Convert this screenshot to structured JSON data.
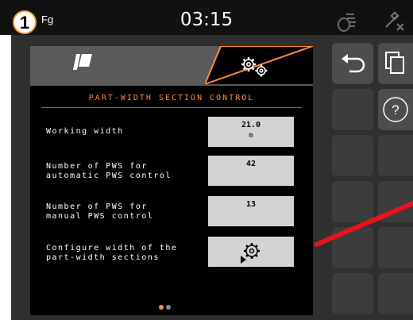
{
  "callout": "1",
  "status_bar": {
    "left_label": "Fg",
    "time": "03:15",
    "icons": [
      "wheel-icon",
      "satellite-disabled-icon"
    ]
  },
  "tabs": [
    {
      "icon": "implement-icon",
      "active": false
    },
    {
      "icon": "settings-gears-icon",
      "active": true
    }
  ],
  "panel": {
    "title": "PART-WIDTH SECTION CONTROL",
    "rows": [
      {
        "label": "Working width",
        "value": "21.0",
        "unit": "m"
      },
      {
        "label": "Number of PWS for\nautomatic PWS control",
        "value": "42"
      },
      {
        "label": "Number of PWS for\nmanual PWS control",
        "value": "13"
      },
      {
        "label": "Configure width of the\npart-width sections",
        "icon": "configure-gear-icon"
      }
    ],
    "page_dots": {
      "count": 2,
      "active": 0
    }
  },
  "softkeys": [
    "back-arrow-icon",
    "copy-pages-icon",
    "help-icon"
  ],
  "colors": {
    "accent": "#ff8a3d",
    "callout_border": "#e9a23b",
    "redline": "#e8141b",
    "value_box": "#d3d3d3"
  }
}
